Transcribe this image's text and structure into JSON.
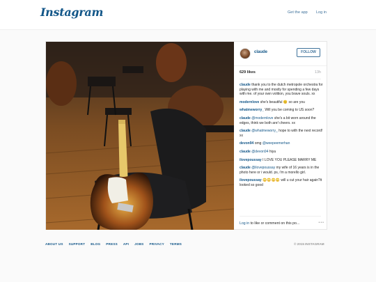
{
  "header": {
    "logo": "Instagram",
    "get_app": "Get the app",
    "login": "Log in"
  },
  "post": {
    "username": "claude",
    "follow_label": "FOLLOW",
    "likes": "629 likes",
    "time": "13h",
    "comments": [
      {
        "user": "claude",
        "segments": [
          {
            "t": "thank you to the dutch metropole orchestra for playing with me and mostly for spending a few days with me. of your own volition, you brave souls. xx",
            "m": false
          }
        ]
      },
      {
        "user": "modernlove",
        "segments": [
          {
            "t": "she's beautiful 😊 so are you",
            "m": false
          }
        ]
      },
      {
        "user": "whatmeworry_",
        "segments": [
          {
            "t": "Will you be coming to US soon?",
            "m": false
          }
        ]
      },
      {
        "user": "claude",
        "segments": [
          {
            "t": "@modernlove",
            "m": true
          },
          {
            "t": " she's a bit worn around the edges, think we both are! cheers. xx",
            "m": false
          }
        ]
      },
      {
        "user": "claude",
        "segments": [
          {
            "t": "@whatmeworry_",
            "m": true
          },
          {
            "t": " hope to with the next record! xx",
            "m": false
          }
        ]
      },
      {
        "user": "devon94",
        "segments": [
          {
            "t": "omg ",
            "m": false
          },
          {
            "t": "@weepeemerhan",
            "m": true
          }
        ]
      },
      {
        "user": "claude",
        "segments": [
          {
            "t": "@devon94",
            "m": true
          },
          {
            "t": " hiya",
            "m": false
          }
        ]
      },
      {
        "user": "ilovepoussay",
        "segments": [
          {
            "t": "I LOVE YOU PLEASE MARRY ME",
            "m": false
          }
        ]
      },
      {
        "user": "claude",
        "segments": [
          {
            "t": "@ilovepoussay",
            "m": true
          },
          {
            "t": " my wife of 16 years is in the photo here or i would. ps, i'm a morello girl.",
            "m": false
          }
        ]
      },
      {
        "user": "ilovepoussay",
        "segments": [
          {
            "t": "😳😳😳😳 will u cut your hair again?it looked so good",
            "m": false
          }
        ]
      }
    ],
    "login_link": "Log in",
    "login_rest": " to like or comment on this po...",
    "more": "•••"
  },
  "footer": {
    "links": [
      "ABOUT US",
      "SUPPORT",
      "BLOG",
      "PRESS",
      "API",
      "JOBS",
      "PRIVACY",
      "TERMS"
    ],
    "copyright": "© 2015 INSTAGRAM"
  },
  "colors": {
    "link": "#125688",
    "button": "#3f729b",
    "muted": "#a5a7aa"
  }
}
